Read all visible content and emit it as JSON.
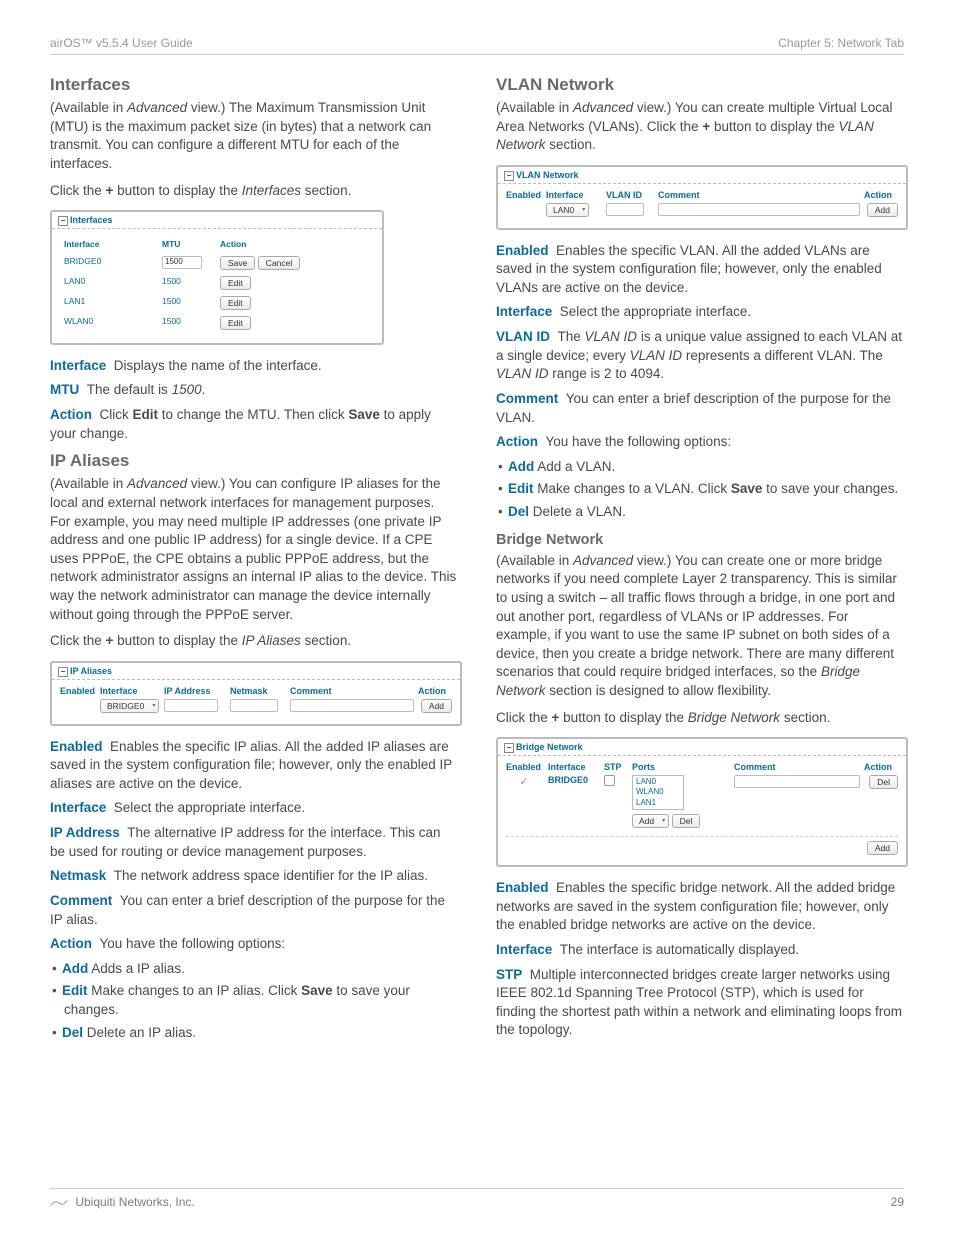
{
  "header": {
    "left": "airOS™ v5.5.4 User Guide",
    "right": "Chapter 5: Network Tab"
  },
  "left": {
    "h_interfaces": "Interfaces",
    "p1": "(Available in Advanced view.) The Maximum Transmission Unit (MTU) is the maximum packet size (in bytes) that a network can transmit. You can configure a different MTU for each of the interfaces.",
    "p2_a": "Click the ",
    "p2_b": " button to display the ",
    "p2_c": " section.",
    "interfaces_img": {
      "title": "Interfaces",
      "cols": {
        "c1": "Interface",
        "c2": "MTU",
        "c3": "Action"
      },
      "rows": [
        {
          "iface": "BRIDGE0",
          "mtu": "1500",
          "b1": "Save",
          "b2": "Cancel"
        },
        {
          "iface": "LAN0",
          "mtu": "1500",
          "b1": "Edit",
          "b2": ""
        },
        {
          "iface": "LAN1",
          "mtu": "1500",
          "b1": "Edit",
          "b2": ""
        },
        {
          "iface": "WLAN0",
          "mtu": "1500",
          "b1": "Edit",
          "b2": ""
        }
      ]
    },
    "d_interface": {
      "t": "Interface",
      "v": "Displays the name of the interface."
    },
    "d_mtu_a": "MTU",
    "d_mtu_b": "The default is ",
    "d_mtu_c": "1500",
    "d_mtu_d": ".",
    "d_action_a": "Action",
    "d_action_b": "Click ",
    "d_action_c": "Edit",
    "d_action_d": " to change the MTU. Then click ",
    "d_action_e": "Save",
    "d_action_f": " to apply your change.",
    "h_ip": "IP Aliases",
    "ip_p1": "(Available in Advanced view.) You can configure IP aliases for the local and external network interfaces for management purposes. For example, you may need multiple IP addresses (one private IP address and one public IP address) for a single device. If a CPE uses PPPoE, the CPE obtains a public PPPoE address, but the network administrator assigns an internal IP alias to the device. This way the network administrator can manage the device internally without going through the PPPoE server.",
    "ip_p2_a": "Click the ",
    "ip_p2_b": " button to display the ",
    "ip_p2_c": " section.",
    "ip_img": {
      "title": "IP Aliases",
      "cols": {
        "c1": "Enabled",
        "c2": "Interface",
        "c3": "IP Address",
        "c4": "Netmask",
        "c5": "Comment",
        "c6": "Action"
      },
      "sel": "BRIDGE0",
      "btn": "Add"
    },
    "ip_d_enabled": {
      "t": "Enabled",
      "v": "Enables the specific IP alias. All the added IP aliases are saved in the system configuration file; however, only the enabled IP aliases are active on the device."
    },
    "ip_d_iface": {
      "t": "Interface",
      "v": "Select the appropriate interface."
    },
    "ip_d_addr": {
      "t": "IP Address",
      "v": "The alternative IP address for the interface. This can be used for routing or device management purposes."
    },
    "ip_d_netmask": {
      "t": "Netmask",
      "v": "The network address space identifier for the IP alias."
    },
    "ip_d_comment": {
      "t": "Comment",
      "v": "You can enter a brief description of the purpose for the IP alias."
    },
    "ip_d_action": {
      "t": "Action",
      "v": "You have the following options:"
    },
    "ip_li1_a": "Add",
    "ip_li1_b": " Adds a IP alias.",
    "ip_li2_a": "Edit",
    "ip_li2_b": " Make changes to an IP alias. Click ",
    "ip_li2_c": "Save",
    "ip_li2_d": " to save your changes.",
    "ip_li3_a": "Del",
    "ip_li3_b": " Delete an IP alias."
  },
  "right": {
    "h_vlan": "VLAN Network",
    "vlan_p1_a": "(Available in ",
    "vlan_p1_b": "Advanced",
    "vlan_p1_c": " view.) You can create multiple Virtual Local Area Networks (VLANs). Click the ",
    "vlan_p1_d": " button to display the ",
    "vlan_p1_e": "VLAN Network",
    "vlan_p1_f": " section.",
    "vlan_img": {
      "title": "VLAN Network",
      "cols": {
        "c1": "Enabled",
        "c2": "Interface",
        "c3": "VLAN ID",
        "c4": "Comment",
        "c5": "Action"
      },
      "sel": "LAN0",
      "btn": "Add"
    },
    "vlan_d_enabled": {
      "t": "Enabled",
      "v": "Enables the specific VLAN. All the added VLANs are saved in the system configuration file; however, only the enabled VLANs are active on the device."
    },
    "vlan_d_iface": {
      "t": "Interface",
      "v": "Select the appropriate interface."
    },
    "vlan_d_id_a": "VLAN ID",
    "vlan_d_id_b": "The ",
    "vlan_d_id_c": "VLAN ID",
    "vlan_d_id_d": " is a unique value assigned to each VLAN at a single device; every ",
    "vlan_d_id_e": "VLAN ID",
    "vlan_d_id_f": " represents a different VLAN. The ",
    "vlan_d_id_g": "VLAN ID",
    "vlan_d_id_h": " range is 2 to 4094.",
    "vlan_d_comment": {
      "t": "Comment",
      "v": "You can enter a brief description of the purpose for the VLAN."
    },
    "vlan_d_action": {
      "t": "Action",
      "v": "You have the following options:"
    },
    "vlan_li1_a": "Add",
    "vlan_li1_b": " Add a VLAN.",
    "vlan_li2_a": "Edit",
    "vlan_li2_b": " Make changes to a VLAN. Click ",
    "vlan_li2_c": "Save",
    "vlan_li2_d": " to save your changes.",
    "vlan_li3_a": "Del",
    "vlan_li3_b": " Delete a VLAN.",
    "h_bridge": "Bridge Network",
    "bridge_p1": "(Available in Advanced view.) You can create one or more bridge networks if you need complete Layer 2 transparency. This is similar to using a switch – all traffic flows through a bridge, in one port and out another port, regardless of VLANs or IP addresses. For example, if you want to use the same IP subnet on both sides of a device, then you create a bridge network. There are many different scenarios that could require bridged interfaces, so the Bridge Network section is designed to allow flexibility.",
    "bridge_p2_a": "Click the ",
    "bridge_p2_b": " button to display the ",
    "bridge_p2_c": "Bridge Network",
    "bridge_p2_d": " section.",
    "bridge_img": {
      "title": "Bridge Network",
      "cols": {
        "c1": "Enabled",
        "c2": "Interface",
        "c3": "STP",
        "c4": "Ports",
        "c5": "Comment",
        "c6": "Action"
      },
      "iface": "BRIDGE0",
      "ports": [
        "LAN0",
        "WLAN0",
        "LAN1"
      ],
      "sel": "Add",
      "del": "Del",
      "add": "Add"
    },
    "br_d_enabled": {
      "t": "Enabled",
      "v": "Enables the specific bridge network. All the added bridge networks are saved in the system configuration file; however, only the enabled bridge networks are active on the device."
    },
    "br_d_iface": {
      "t": "Interface",
      "v": "The interface is automatically displayed."
    },
    "br_d_stp": {
      "t": "STP",
      "v": "Multiple interconnected bridges create larger networks using IEEE 802.1d Spanning Tree Protocol (STP), which is used for finding the shortest path within a network and eliminating loops from the topology."
    }
  },
  "footer": {
    "company": "Ubiquiti Networks, Inc.",
    "page": "29"
  },
  "sym": {
    "plus": "+",
    "minus": "−"
  }
}
